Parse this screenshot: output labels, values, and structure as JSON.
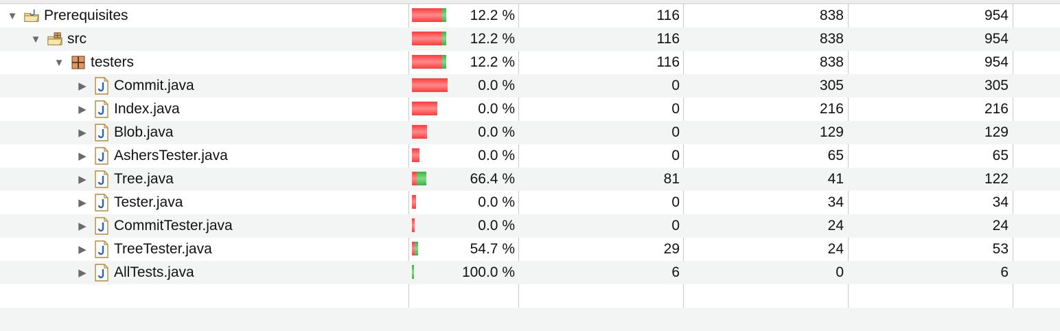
{
  "colors": {
    "missed": "#ff3b3b",
    "covered": "#3cb043",
    "alt_row": "#f3f4f4"
  },
  "rows": [
    {
      "label": "Prerequisites",
      "icon": "project-folder-icon",
      "expanded": true,
      "level": 0,
      "pct": "12.2 %",
      "covered": "116",
      "missed": "838",
      "total": "954",
      "covered_fraction": 0.122
    },
    {
      "label": "src",
      "icon": "source-folder-icon",
      "expanded": true,
      "level": 1,
      "pct": "12.2 %",
      "covered": "116",
      "missed": "838",
      "total": "954",
      "covered_fraction": 0.122
    },
    {
      "label": "testers",
      "icon": "package-icon",
      "expanded": true,
      "level": 2,
      "pct": "12.2 %",
      "covered": "116",
      "missed": "838",
      "total": "954",
      "covered_fraction": 0.122
    },
    {
      "label": "Commit.java",
      "icon": "java-file-icon",
      "expanded": false,
      "level": 3,
      "pct": "0.0 %",
      "covered": "0",
      "missed": "305",
      "total": "305",
      "covered_fraction": 0.0
    },
    {
      "label": "Index.java",
      "icon": "java-file-icon",
      "expanded": false,
      "level": 3,
      "pct": "0.0 %",
      "covered": "0",
      "missed": "216",
      "total": "216",
      "covered_fraction": 0.0
    },
    {
      "label": "Blob.java",
      "icon": "java-file-icon",
      "expanded": false,
      "level": 3,
      "pct": "0.0 %",
      "covered": "0",
      "missed": "129",
      "total": "129",
      "covered_fraction": 0.0
    },
    {
      "label": "AshersTester.java",
      "icon": "java-file-icon",
      "expanded": false,
      "level": 3,
      "pct": "0.0 %",
      "covered": "0",
      "missed": "65",
      "total": "65",
      "covered_fraction": 0.0
    },
    {
      "label": "Tree.java",
      "icon": "java-file-icon",
      "expanded": false,
      "level": 3,
      "pct": "66.4 %",
      "covered": "81",
      "missed": "41",
      "total": "122",
      "covered_fraction": 0.664
    },
    {
      "label": "Tester.java",
      "icon": "java-file-icon",
      "expanded": false,
      "level": 3,
      "pct": "0.0 %",
      "covered": "0",
      "missed": "34",
      "total": "34",
      "covered_fraction": 0.0
    },
    {
      "label": "CommitTester.java",
      "icon": "java-file-icon",
      "expanded": false,
      "level": 3,
      "pct": "0.0 %",
      "covered": "0",
      "missed": "24",
      "total": "24",
      "covered_fraction": 0.0
    },
    {
      "label": "TreeTester.java",
      "icon": "java-file-icon",
      "expanded": false,
      "level": 3,
      "pct": "54.7 %",
      "covered": "29",
      "missed": "24",
      "total": "53",
      "covered_fraction": 0.547
    },
    {
      "label": "AllTests.java",
      "icon": "java-file-icon",
      "expanded": false,
      "level": 3,
      "pct": "100.0 %",
      "covered": "6",
      "missed": "0",
      "total": "6",
      "covered_fraction": 1.0
    }
  ]
}
